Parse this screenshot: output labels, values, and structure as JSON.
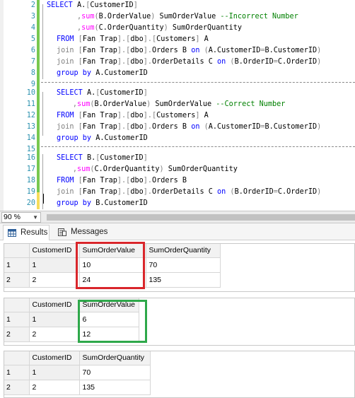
{
  "editor": {
    "lines": [
      {
        "n": "2",
        "segs": [
          [
            "kw",
            "SELECT "
          ],
          [
            "",
            "A."
          ],
          [
            "op",
            "["
          ],
          [
            "",
            "CustomerID"
          ],
          [
            "op",
            "]"
          ]
        ]
      },
      {
        "n": "3",
        "segs": [
          [
            "",
            "       "
          ],
          [
            "op",
            ","
          ],
          [
            "fn",
            "sum"
          ],
          [
            "op",
            "("
          ],
          [
            "",
            "B.OrderValue"
          ],
          [
            "op",
            ")"
          ],
          [
            "",
            " SumOrderValue "
          ],
          [
            "cm",
            "--Incorrect Number"
          ]
        ]
      },
      {
        "n": "4",
        "segs": [
          [
            "",
            "       "
          ],
          [
            "op",
            ","
          ],
          [
            "fn",
            "sum"
          ],
          [
            "op",
            "("
          ],
          [
            "",
            "C.OrderQuantity"
          ],
          [
            "op",
            ")"
          ],
          [
            "",
            " SumOrderQuantity"
          ]
        ]
      },
      {
        "n": "5",
        "segs": [
          [
            "",
            ""
          ],
          [
            "kw",
            "FROM "
          ],
          [
            "op",
            "["
          ],
          [
            "",
            "Fan Trap"
          ],
          [
            "op",
            "]"
          ],
          [
            "op",
            "."
          ],
          [
            "op",
            "["
          ],
          [
            "",
            "dbo"
          ],
          [
            "op",
            "]"
          ],
          [
            "op",
            "."
          ],
          [
            "op",
            "["
          ],
          [
            "",
            "Customers"
          ],
          [
            "op",
            "]"
          ],
          [
            "",
            " A"
          ]
        ]
      },
      {
        "n": "6",
        "segs": [
          [
            "op",
            "join "
          ],
          [
            "op",
            "["
          ],
          [
            "",
            "Fan Trap"
          ],
          [
            "op",
            "]"
          ],
          [
            "op",
            "."
          ],
          [
            "op",
            "["
          ],
          [
            "",
            "dbo"
          ],
          [
            "op",
            "]"
          ],
          [
            "op",
            "."
          ],
          [
            "",
            "Orders B "
          ],
          [
            "kw",
            "on "
          ],
          [
            "op",
            "("
          ],
          [
            "",
            "A.CustomerID"
          ],
          [
            "op",
            "="
          ],
          [
            "",
            "B.CustomerID"
          ],
          [
            "op",
            ")"
          ]
        ]
      },
      {
        "n": "7",
        "segs": [
          [
            "op",
            "join "
          ],
          [
            "op",
            "["
          ],
          [
            "",
            "Fan Trap"
          ],
          [
            "op",
            "]"
          ],
          [
            "op",
            "."
          ],
          [
            "op",
            "["
          ],
          [
            "",
            "dbo"
          ],
          [
            "op",
            "]"
          ],
          [
            "op",
            "."
          ],
          [
            "",
            "OrderDetails C "
          ],
          [
            "kw",
            "on "
          ],
          [
            "op",
            "("
          ],
          [
            "",
            "B.OrderID"
          ],
          [
            "op",
            "="
          ],
          [
            "",
            "C.OrderID"
          ],
          [
            "op",
            ")"
          ]
        ]
      },
      {
        "n": "8",
        "segs": [
          [
            "kw",
            "group by "
          ],
          [
            "",
            "A.CustomerID"
          ]
        ]
      },
      {
        "n": "9",
        "segs": []
      },
      {
        "n": "10",
        "segs": [
          [
            "kw",
            "SELECT "
          ],
          [
            "",
            "A."
          ],
          [
            "op",
            "["
          ],
          [
            "",
            "CustomerID"
          ],
          [
            "op",
            "]"
          ]
        ]
      },
      {
        "n": "11",
        "segs": [
          [
            "",
            "      "
          ],
          [
            "op",
            ","
          ],
          [
            "fn",
            "sum"
          ],
          [
            "op",
            "("
          ],
          [
            "",
            "B.OrderValue"
          ],
          [
            "op",
            ")"
          ],
          [
            "",
            " SumOrderValue "
          ],
          [
            "cm",
            "--Correct Number"
          ]
        ]
      },
      {
        "n": "12",
        "segs": [
          [
            "kw",
            "FROM "
          ],
          [
            "op",
            "["
          ],
          [
            "",
            "Fan Trap"
          ],
          [
            "op",
            "]"
          ],
          [
            "op",
            "."
          ],
          [
            "op",
            "["
          ],
          [
            "",
            "dbo"
          ],
          [
            "op",
            "]"
          ],
          [
            "op",
            "."
          ],
          [
            "op",
            "["
          ],
          [
            "",
            "Customers"
          ],
          [
            "op",
            "]"
          ],
          [
            "",
            " A"
          ]
        ]
      },
      {
        "n": "13",
        "segs": [
          [
            "op",
            "join "
          ],
          [
            "op",
            "["
          ],
          [
            "",
            "Fan Trap"
          ],
          [
            "op",
            "]"
          ],
          [
            "op",
            "."
          ],
          [
            "op",
            "["
          ],
          [
            "",
            "dbo"
          ],
          [
            "op",
            "]"
          ],
          [
            "op",
            "."
          ],
          [
            "",
            "Orders B "
          ],
          [
            "kw",
            "on "
          ],
          [
            "op",
            "("
          ],
          [
            "",
            "A.CustomerID"
          ],
          [
            "op",
            "="
          ],
          [
            "",
            "B.CustomerID"
          ],
          [
            "op",
            ")"
          ]
        ]
      },
      {
        "n": "14",
        "segs": [
          [
            "kw",
            "group by "
          ],
          [
            "",
            "A.CustomerID"
          ]
        ]
      },
      {
        "n": "15",
        "segs": []
      },
      {
        "n": "16",
        "segs": [
          [
            "kw",
            "SELECT "
          ],
          [
            "",
            "B."
          ],
          [
            "op",
            "["
          ],
          [
            "",
            "CustomerID"
          ],
          [
            "op",
            "]"
          ]
        ]
      },
      {
        "n": "17",
        "segs": [
          [
            "",
            "      "
          ],
          [
            "op",
            ","
          ],
          [
            "fn",
            "sum"
          ],
          [
            "op",
            "("
          ],
          [
            "",
            "C.OrderQuantity"
          ],
          [
            "op",
            ")"
          ],
          [
            "",
            " SumOrderQuantity"
          ]
        ]
      },
      {
        "n": "18",
        "segs": [
          [
            "kw",
            "FROM "
          ],
          [
            "op",
            "["
          ],
          [
            "",
            "Fan Trap"
          ],
          [
            "op",
            "]"
          ],
          [
            "op",
            "."
          ],
          [
            "op",
            "["
          ],
          [
            "",
            "dbo"
          ],
          [
            "op",
            "]"
          ],
          [
            "op",
            "."
          ],
          [
            "",
            "Orders B"
          ]
        ]
      },
      {
        "n": "19",
        "segs": [
          [
            "op",
            "join "
          ],
          [
            "op",
            "["
          ],
          [
            "",
            "Fan Trap"
          ],
          [
            "op",
            "]"
          ],
          [
            "op",
            "."
          ],
          [
            "op",
            "["
          ],
          [
            "",
            "dbo"
          ],
          [
            "op",
            "]"
          ],
          [
            "op",
            "."
          ],
          [
            "",
            "OrderDetails C "
          ],
          [
            "kw",
            "on "
          ],
          [
            "op",
            "("
          ],
          [
            "",
            "B.OrderID"
          ],
          [
            "op",
            "="
          ],
          [
            "",
            "C.OrderID"
          ],
          [
            "op",
            ")"
          ]
        ]
      },
      {
        "n": "20",
        "segs": [
          [
            "kw",
            "group by "
          ],
          [
            "",
            "B.CustomerID"
          ]
        ]
      }
    ]
  },
  "zoom": {
    "value": "90 %"
  },
  "tabs": {
    "results": "Results",
    "messages": "Messages"
  },
  "grids": [
    {
      "columns": [
        "CustomerID",
        "SumOrderValue",
        "SumOrderQuantity"
      ],
      "rows": [
        {
          "rn": "1",
          "cells": [
            "1",
            "10",
            "70"
          ]
        },
        {
          "rn": "2",
          "cells": [
            "2",
            "24",
            "135"
          ]
        }
      ],
      "highlight_color": "#d9262b"
    },
    {
      "columns": [
        "CustomerID",
        "SumOrderValue"
      ],
      "rows": [
        {
          "rn": "1",
          "cells": [
            "1",
            "6"
          ]
        },
        {
          "rn": "2",
          "cells": [
            "2",
            "12"
          ]
        }
      ],
      "highlight_color": "#2ea84a"
    },
    {
      "columns": [
        "CustomerID",
        "SumOrderQuantity"
      ],
      "rows": [
        {
          "rn": "1",
          "cells": [
            "1",
            "70"
          ]
        },
        {
          "rn": "2",
          "cells": [
            "2",
            "135"
          ]
        }
      ]
    }
  ],
  "colors": {
    "keyword": "#0000ff",
    "function": "#ff00ff",
    "operator": "#808080",
    "comment": "#008000",
    "line_number": "#2b91af"
  }
}
